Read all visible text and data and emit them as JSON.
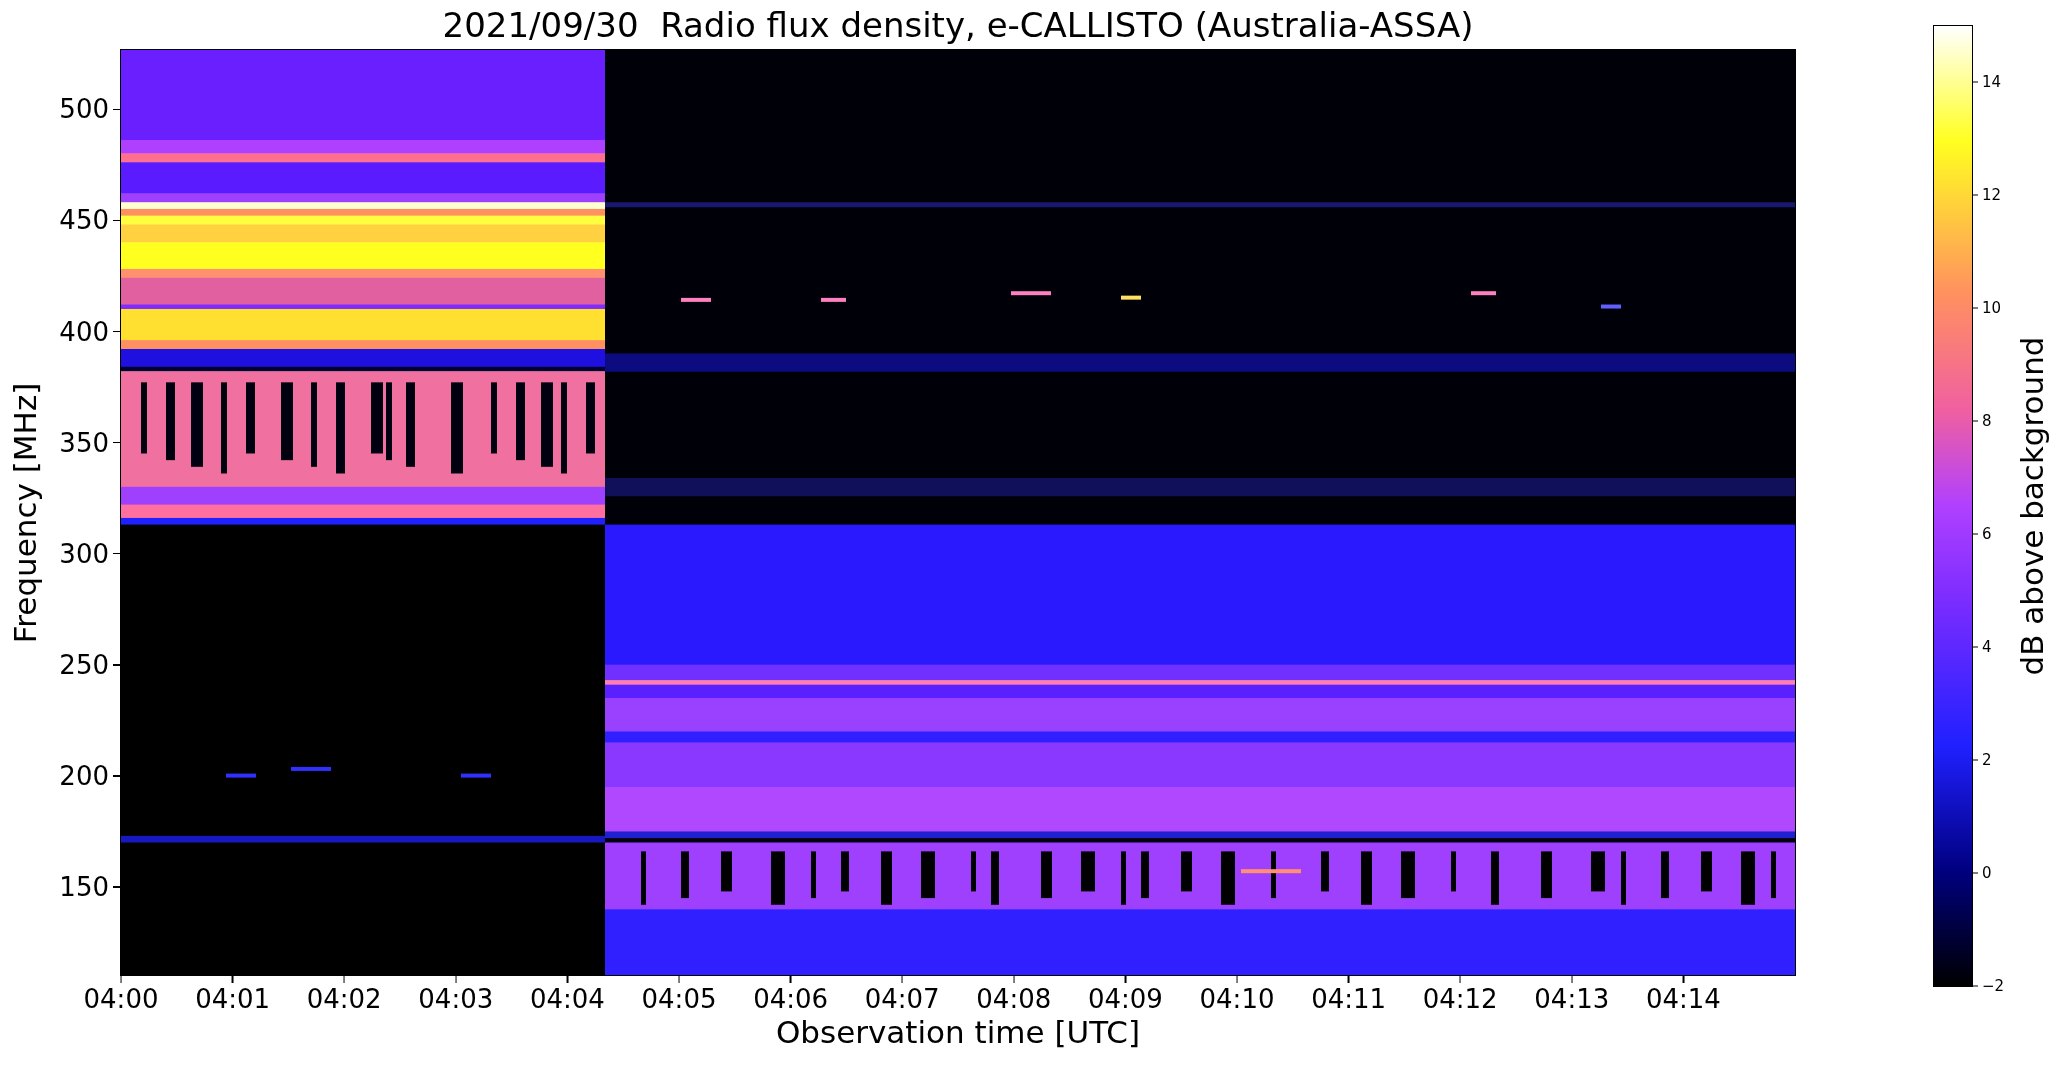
{
  "title": "2021/09/30  Radio flux density, e-CALLISTO (Australia-ASSA)",
  "y_axis": {
    "label": "Frequency [MHz]",
    "ticks": [
      "500",
      "450",
      "400",
      "350",
      "300",
      "250",
      "200",
      "150"
    ]
  },
  "x_axis": {
    "label": "Observation time [UTC]",
    "ticks": [
      "04:00",
      "04:01",
      "04:02",
      "04:03",
      "04:04",
      "04:05",
      "04:06",
      "04:07",
      "04:08",
      "04:09",
      "04:10",
      "04:11",
      "04:12",
      "04:13",
      "04:14"
    ]
  },
  "colorbar": {
    "label": "dB above background",
    "ticks": [
      "14",
      "12",
      "10",
      "8",
      "6",
      "4",
      "2",
      "0",
      "−2"
    ]
  }
}
